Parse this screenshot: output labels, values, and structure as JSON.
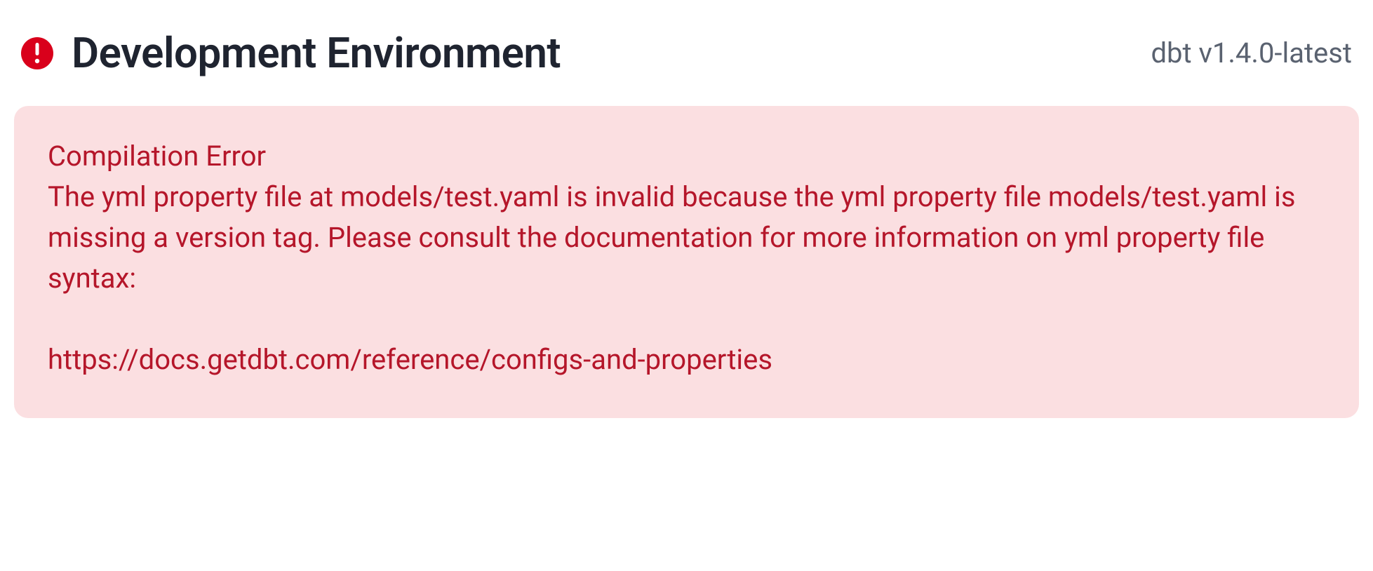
{
  "header": {
    "title": "Development Environment",
    "version": "dbt v1.4.0-latest"
  },
  "error": {
    "title": "Compilation Error",
    "message": "The yml property file at models/test.yaml is invalid because the yml property file models/test.yaml is missing a version tag. Please consult the documentation for more information on yml property file syntax:\n\nhttps://docs.getdbt.com/reference/configs-and-properties"
  },
  "colors": {
    "error_icon_bg": "#d9001b",
    "error_panel_bg": "#fbdfe1",
    "error_text": "#b5162a",
    "title_text": "#1f2430",
    "version_text": "#5a6270"
  }
}
